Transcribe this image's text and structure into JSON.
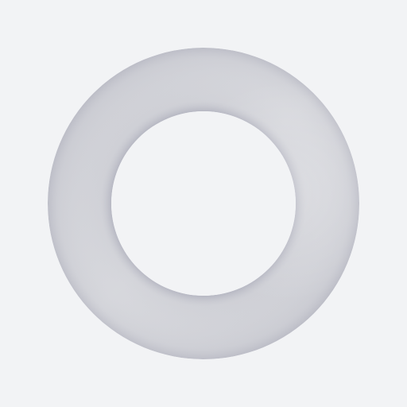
{
  "colors": {
    "background": "#f2f3f5",
    "ring_light": "#d6d7dc",
    "ring_mid": "#c9cad1",
    "ring_dark": "#a9aab8"
  },
  "icon": {
    "name": "ring-icon"
  }
}
